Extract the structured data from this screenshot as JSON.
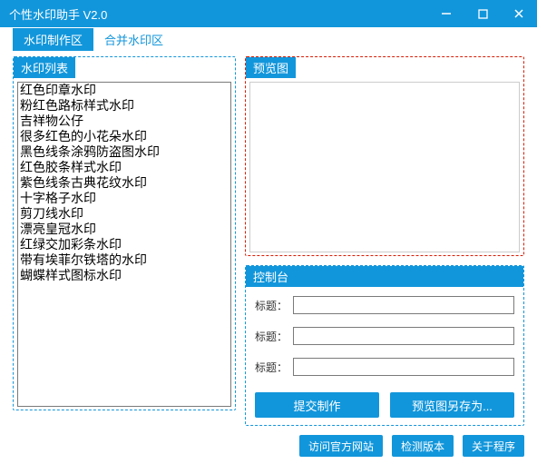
{
  "window": {
    "title": "个性水印助手 V2.0"
  },
  "tabs": [
    {
      "label": "水印制作区"
    },
    {
      "label": "合并水印区"
    }
  ],
  "panels": {
    "list_label": "水印列表",
    "preview_label": "预览图",
    "console_label": "控制台"
  },
  "watermark_list": [
    "红色印章水印",
    "粉红色路标样式水印",
    "吉祥物公仔",
    "很多红色的小花朵水印",
    "黑色线条涂鸦防盗图水印",
    "红色胶条样式水印",
    "紫色线条古典花纹水印",
    "十字格子水印",
    "剪刀线水印",
    "漂亮皇冠水印",
    "红绿交加彩条水印",
    "带有埃菲尔铁塔的水印",
    "蝴蝶样式图标水印"
  ],
  "console": {
    "field1_label": "标题：",
    "field2_label": "标题：",
    "field3_label": "标题：",
    "field1_value": "",
    "field2_value": "",
    "field3_value": "",
    "submit_label": "提交制作",
    "saveas_label": "预览图另存为..."
  },
  "footer": {
    "website_label": "访问官方网站",
    "checkver_label": "检测版本",
    "about_label": "关于程序"
  }
}
